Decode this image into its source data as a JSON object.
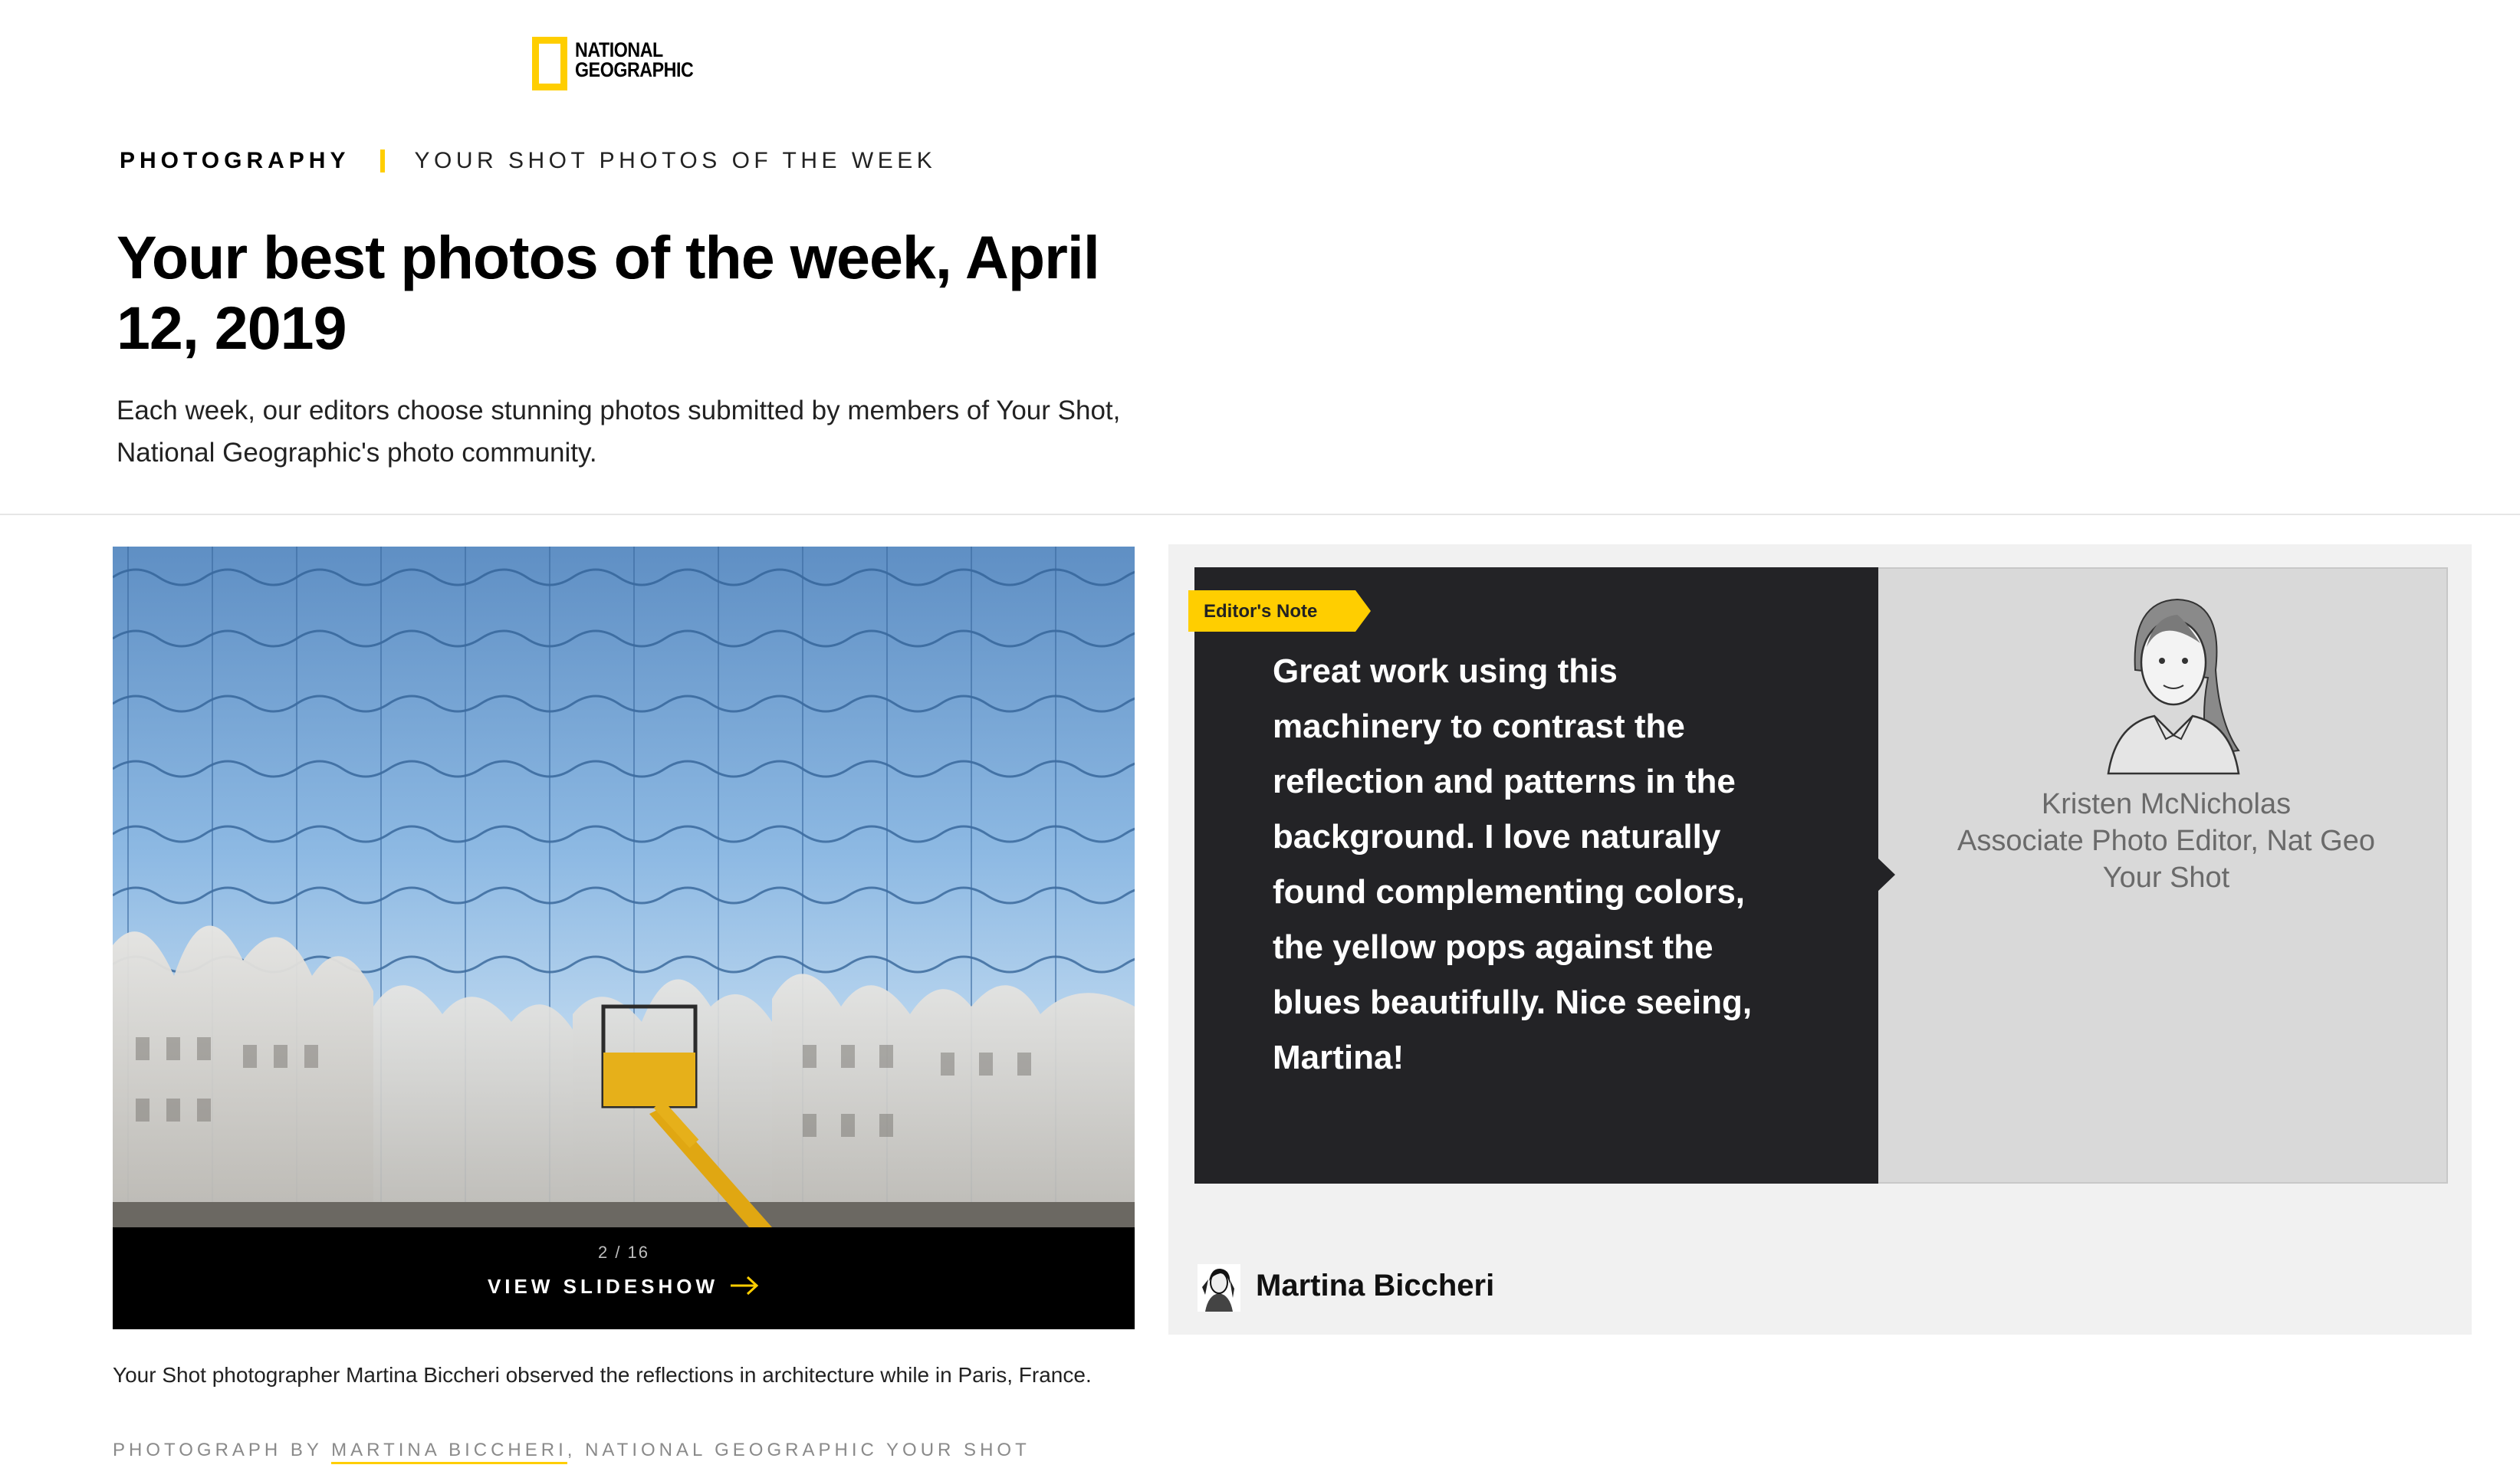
{
  "brand": {
    "line1": "NATIONAL",
    "line2": "GEOGRAPHIC",
    "accent_color": "#FFCE00"
  },
  "breadcrumb": {
    "section": "PHOTOGRAPHY",
    "topic": "YOUR SHOT PHOTOS OF THE WEEK"
  },
  "article": {
    "title": "Your best photos of the week, April 12, 2019",
    "dek": "Each week, our editors choose stunning photos submitted by members of Your Shot, National Geographic's photo community."
  },
  "slideshow": {
    "counter": "2 / 16",
    "cta": "VIEW SLIDESHOW",
    "arrow_icon": "arrow-right-icon"
  },
  "photo": {
    "caption": "Your Shot photographer Martina Biccheri observed the reflections in architecture while in Paris, France.",
    "credit_prefix": "PHOTOGRAPH BY ",
    "credit_name": "MARTINA BICCHERI",
    "credit_suffix": ", NATIONAL GEOGRAPHIC YOUR SHOT"
  },
  "editors_note": {
    "tag": "Editor's Note",
    "quote": "Great work using this machinery to contrast the reflection and patterns in the background. I love naturally found complementing colors, the yellow pops against the blues beautifully. Nice seeing, Martina!",
    "editor_name": "Kristen McNicholas",
    "editor_title_line1": "Associate Photo Editor, Nat Geo",
    "editor_title_line2": "Your Shot"
  },
  "photographer": {
    "name": "Martina Biccheri"
  }
}
